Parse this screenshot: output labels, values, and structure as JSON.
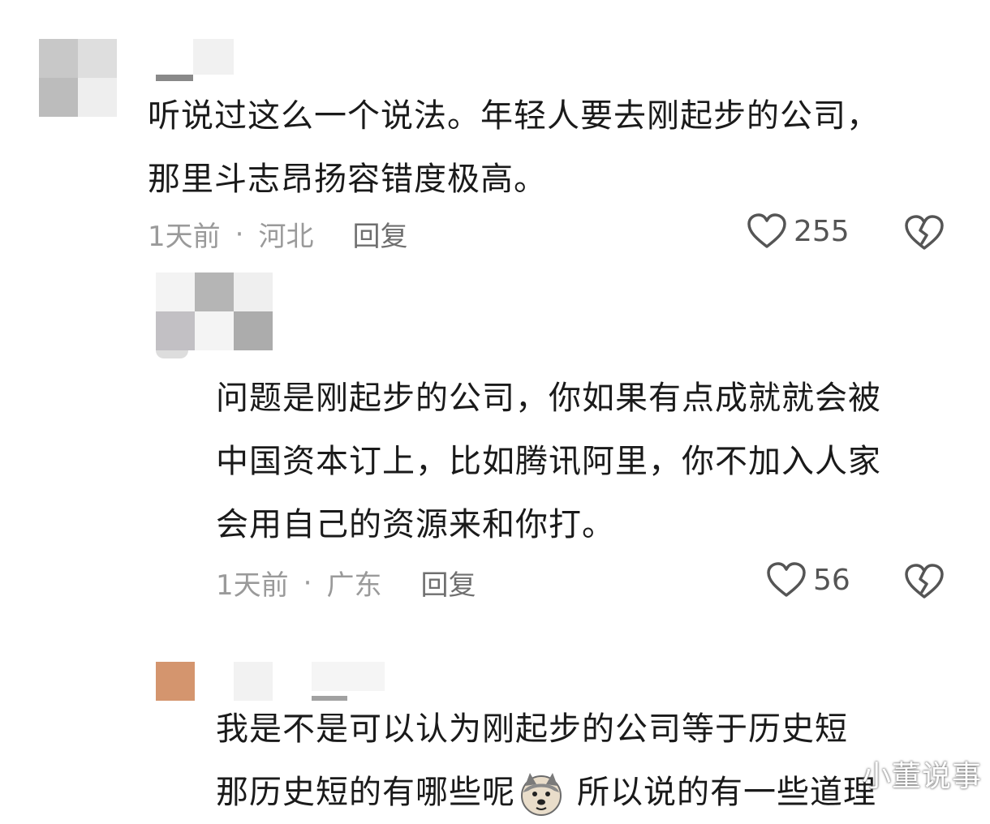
{
  "comments": [
    {
      "text_line1": "听说过这么一个说法。年轻人要去刚起步的公司，",
      "text_line2": "那里斗志昂扬容错度极高。",
      "time": "1天前",
      "location": "河北",
      "reply_label": "回复",
      "likes": "255"
    },
    {
      "text_line1": "问题是刚起步的公司，你如果有点成就就会被",
      "text_line2": "中国资本订上，比如腾讯阿里，你不加入人家",
      "text_line3": "会用自己的资源来和你打。",
      "time": "1天前",
      "location": "广东",
      "reply_label": "回复",
      "likes": "56"
    },
    {
      "text_line1": "我是不是可以认为刚起步的公司等于历史短",
      "text_line2_a": "那历史短的有哪些呢",
      "text_line2_b": "所以说的有一些道理"
    }
  ],
  "separator": "·",
  "watermark": "小董说事",
  "icons": {
    "like": "heart-outline-icon",
    "dislike": "broken-heart-icon",
    "emoji": "doge-emoji-icon"
  },
  "colors": {
    "text": "#1a1a1a",
    "meta": "#9a9a9a",
    "avatar_orange": "#d4956e"
  }
}
